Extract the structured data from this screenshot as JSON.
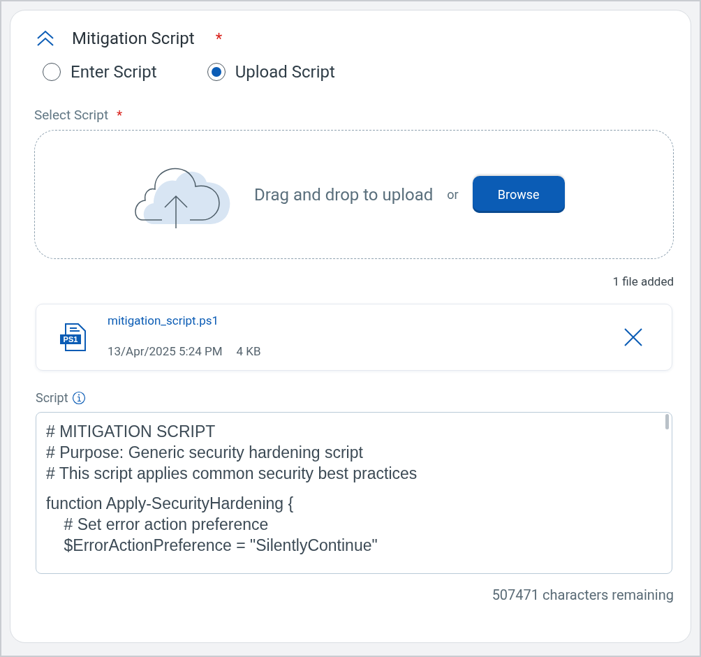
{
  "section": {
    "title": "Mitigation Script",
    "required_mark": "*",
    "expanded": true
  },
  "mode_options": [
    {
      "label": "Enter Script",
      "selected": false
    },
    {
      "label": "Upload Script",
      "selected": true
    }
  ],
  "select_script": {
    "label": "Select Script",
    "required_mark": "*"
  },
  "dropzone": {
    "text": "Drag and drop to upload",
    "separator": "or",
    "button": "Browse"
  },
  "file_count": "1 file added",
  "files": [
    {
      "badge": "PS1",
      "name": "mitigation_script.ps1",
      "date": "13/Apr/2025 5:24 PM",
      "size": "4 KB"
    }
  ],
  "script": {
    "label": "Script",
    "blocks": [
      [
        "# MITIGATION SCRIPT",
        "# Purpose: Generic security hardening script",
        "# This script applies common security best practices"
      ],
      [
        "function Apply-SecurityHardening {",
        "    # Set error action preference",
        "    $ErrorActionPreference = \"SilentlyContinue\""
      ]
    ],
    "remaining": "507471 characters remaining"
  }
}
